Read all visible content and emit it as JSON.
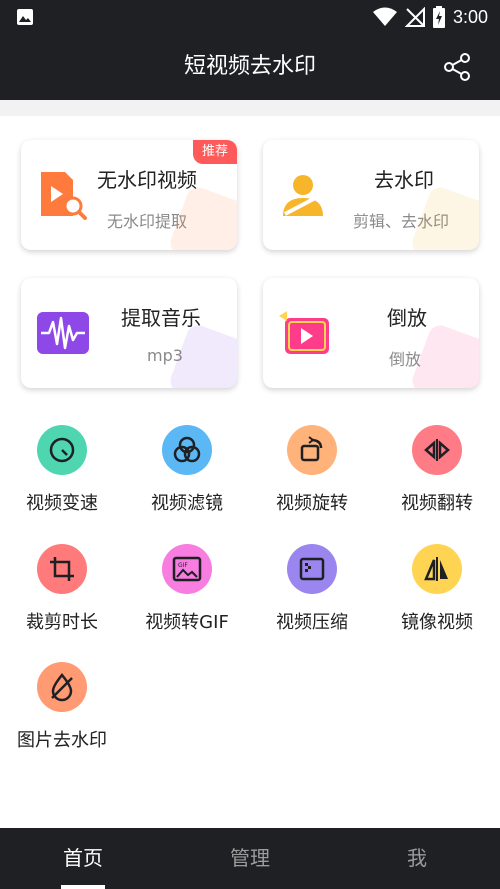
{
  "status_bar": {
    "time": "3:00"
  },
  "app_bar": {
    "title": "短视频去水印"
  },
  "cards": [
    {
      "title": "无水印视频",
      "subtitle": "无水印提取",
      "badge": "推荐",
      "icon": "video-search-icon",
      "color": "#ff7a3d"
    },
    {
      "title": "去水印",
      "subtitle": "剪辑、去水印",
      "icon": "person-erase-icon",
      "color": "#f7b52a"
    },
    {
      "title": "提取音乐",
      "subtitle": "mp3",
      "icon": "audio-wave-icon",
      "color": "#8e48e8"
    },
    {
      "title": "倒放",
      "subtitle": "倒放",
      "icon": "reverse-play-icon",
      "color": "#ff3c8a"
    }
  ],
  "tools": [
    {
      "label": "视频变速",
      "icon": "speed-gauge-icon",
      "color": "#4fd6b0"
    },
    {
      "label": "视频滤镜",
      "icon": "filter-icon",
      "color": "#5bb8f5"
    },
    {
      "label": "视频旋转",
      "icon": "rotate-icon",
      "color": "#ffb27a"
    },
    {
      "label": "视频翻转",
      "icon": "flip-icon",
      "color": "#ff7b86"
    },
    {
      "label": "裁剪时长",
      "icon": "crop-icon",
      "color": "#ff7a7a"
    },
    {
      "label": "视频转GIF",
      "icon": "gif-icon",
      "color": "#f77de0"
    },
    {
      "label": "视频压缩",
      "icon": "compress-icon",
      "color": "#9b86f0"
    },
    {
      "label": "镜像视频",
      "icon": "mirror-icon",
      "color": "#ffd452"
    },
    {
      "label": "图片去水印",
      "icon": "image-erase-icon",
      "color": "#ff9a72"
    }
  ],
  "bottom_nav": [
    {
      "label": "首页",
      "active": true
    },
    {
      "label": "管理",
      "active": false
    },
    {
      "label": "我",
      "active": false
    }
  ]
}
